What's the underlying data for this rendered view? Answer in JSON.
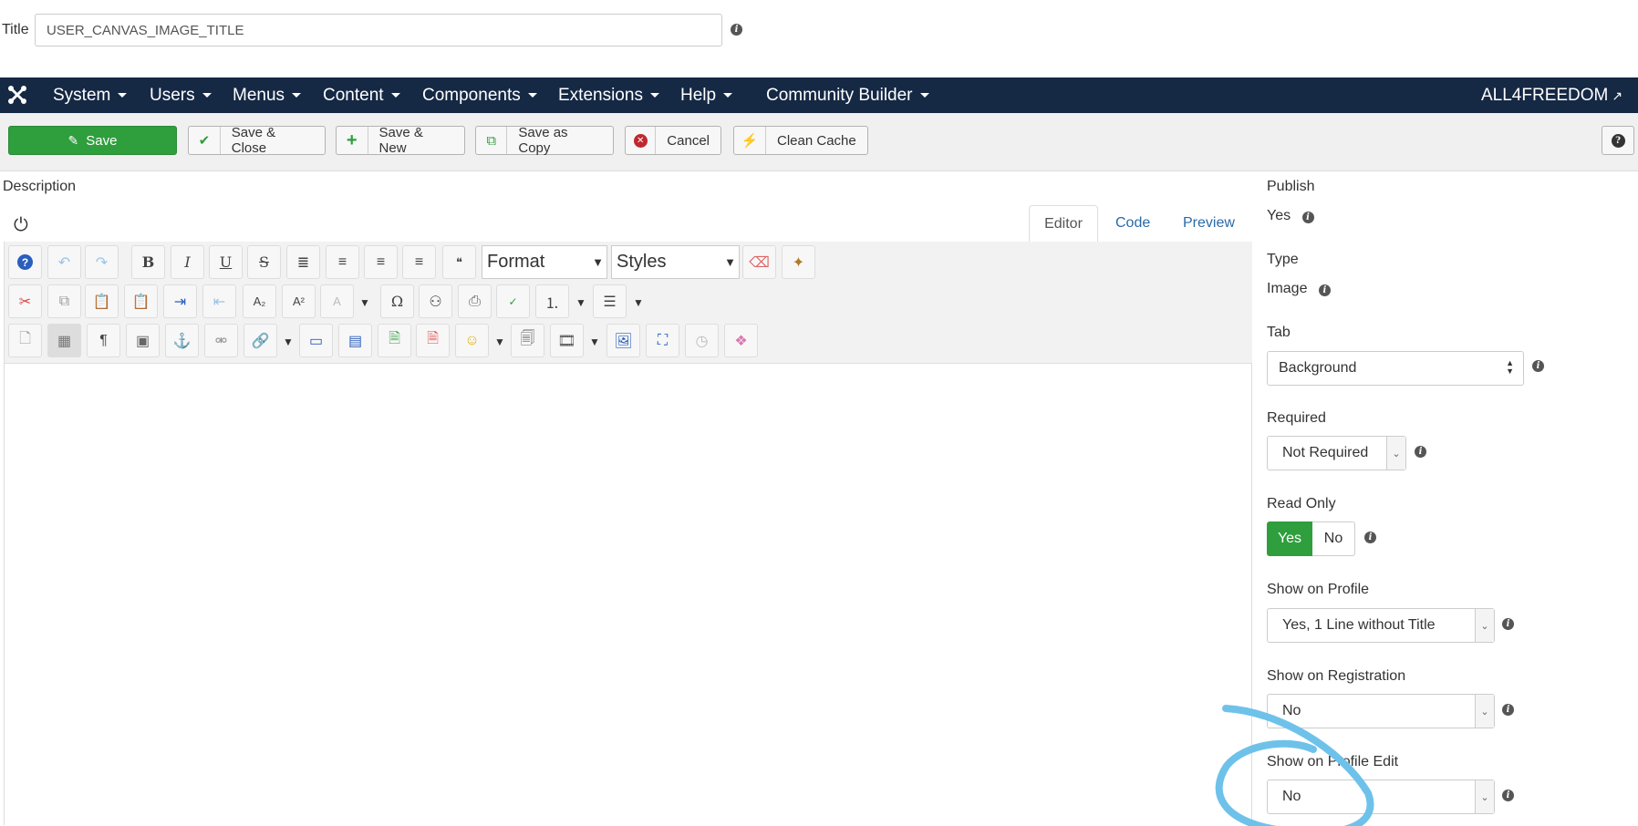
{
  "title_field": {
    "label": "Title",
    "value": "USER_CANVAS_IMAGE_TITLE"
  },
  "navbar": {
    "items": [
      {
        "label": "System"
      },
      {
        "label": "Users"
      },
      {
        "label": "Menus"
      },
      {
        "label": "Content"
      },
      {
        "label": "Components"
      },
      {
        "label": "Extensions"
      },
      {
        "label": "Help"
      },
      {
        "label": "Community Builder"
      }
    ],
    "site_label": "ALL4FREEDOM",
    "colors": {
      "background": "#152844"
    }
  },
  "toolbar": {
    "save": "Save",
    "save_close": "Save & Close",
    "save_new": "Save & New",
    "save_copy": "Save as Copy",
    "cancel": "Cancel",
    "clean_cache": "Clean Cache",
    "colors": {
      "save": "#2f9e3d",
      "cancel_icon": "#c0282f"
    }
  },
  "description": {
    "label": "Description"
  },
  "editor": {
    "tabs": {
      "editor": "Editor",
      "code": "Code",
      "preview": "Preview"
    },
    "format_select": "Format",
    "styles_select": "Styles",
    "buttons": {
      "bold": "B",
      "italic": "I",
      "underline": "U",
      "strike": "S",
      "paragraph": "¶",
      "omega": "Ω",
      "subscript": "A₂",
      "superscript": "A²"
    }
  },
  "panel": {
    "publish": {
      "label": "Publish",
      "value": "Yes"
    },
    "type": {
      "label": "Type",
      "value": "Image"
    },
    "tab": {
      "label": "Tab",
      "value": "Background"
    },
    "required": {
      "label": "Required",
      "value": "Not Required"
    },
    "read_only": {
      "label": "Read Only",
      "yes": "Yes",
      "no": "No",
      "selected": "Yes"
    },
    "show_on_profile": {
      "label": "Show on Profile",
      "value": "Yes, 1 Line without Title"
    },
    "show_on_registration": {
      "label": "Show on Registration",
      "value": "No"
    },
    "show_on_profile_edit": {
      "label": "Show on Profile Edit",
      "value": "No"
    }
  }
}
